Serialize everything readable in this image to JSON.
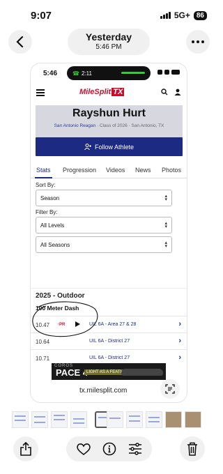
{
  "os_status": {
    "time": "9:07",
    "network": "5G+",
    "battery": "86"
  },
  "viewer": {
    "title": "Yesterday",
    "subtitle": "5:46 PM"
  },
  "screenshot": {
    "status_time": "5:46",
    "call_time": "2:11",
    "site": {
      "logo_text": "MileSplit",
      "logo_badge": "TX"
    },
    "athlete": {
      "name": "Rayshun Hurt",
      "school": "San Antonio Reagan",
      "meta": " · Class of 2026 · San Antonio, TX"
    },
    "follow_label": "Follow Athlete",
    "tabs": [
      "Stats",
      "Progression",
      "Videos",
      "News",
      "Photos"
    ],
    "active_tab": "Stats",
    "sort_by": {
      "label": "Sort By:",
      "value": "Season"
    },
    "filter_by": {
      "label": "Filter By:",
      "levels": "All Levels",
      "seasons": "All Seasons"
    },
    "season_heading": "2025 - Outdoor",
    "event": "100 Meter Dash",
    "results": [
      {
        "mark": "10.47",
        "pr": "PR",
        "meet": "UIL 6A - Area 27 & 28"
      },
      {
        "mark": "10.64",
        "meet": "UIL 6A - District 27"
      },
      {
        "mark": "10.71",
        "meet": "UIL 6A - District 27"
      }
    ],
    "ad": {
      "brand": "COROS",
      "headline": "PACE 4",
      "tag": "LIGHT AS A FEATHER"
    },
    "url": "tx.milesplit.com"
  },
  "toolbar": {
    "icons": [
      "share-icon",
      "heart-icon",
      "info-icon",
      "adjust-icon",
      "trash-icon"
    ]
  }
}
